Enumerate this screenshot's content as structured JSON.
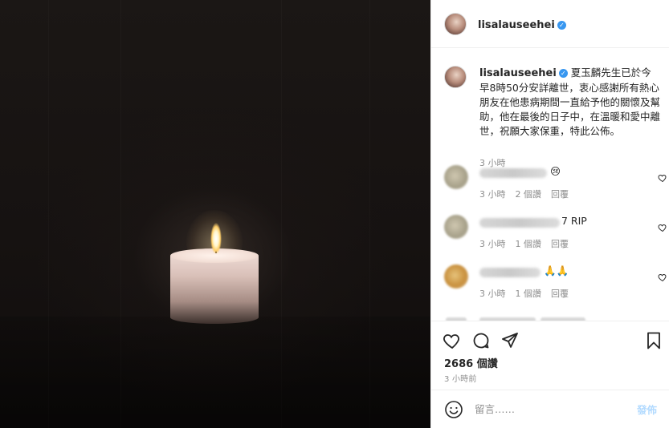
{
  "header": {
    "username": "lisalauseehei",
    "verified": true
  },
  "caption": {
    "username": "lisalauseehei",
    "text": "夏玉麟先生已於今早8時50分安詳離世，衷心感謝所有熱心朋友在他患病期間一直給予他的關懷及幫助，他在最後的日子中，在溫暖和愛中離世，祝願大家保重，特此公佈。",
    "time": "3 小時"
  },
  "comments": [
    {
      "text_suffix": "😢",
      "time": "3 小時",
      "likes": "2 個讚",
      "reply": "回覆"
    },
    {
      "text_suffix": "7 RIP",
      "time": "3 小時",
      "likes": "1 個讚",
      "reply": "回覆"
    },
    {
      "text_suffix": "🙏🙏",
      "time": "3 小時",
      "likes": "1 個讚",
      "reply": "回覆"
    }
  ],
  "actions": {
    "likes": "2686 個讚",
    "posted": "3 小時前"
  },
  "comment_box": {
    "placeholder": "留言……",
    "post_label": "發佈"
  },
  "colors": {
    "verified_blue": "#3897f0",
    "post_button_disabled": "#b3dbff",
    "muted_text": "#8e8e8e"
  },
  "icons": [
    "heart-icon",
    "comment-icon",
    "share-icon",
    "bookmark-icon",
    "emoji-icon",
    "verified-badge-icon"
  ]
}
